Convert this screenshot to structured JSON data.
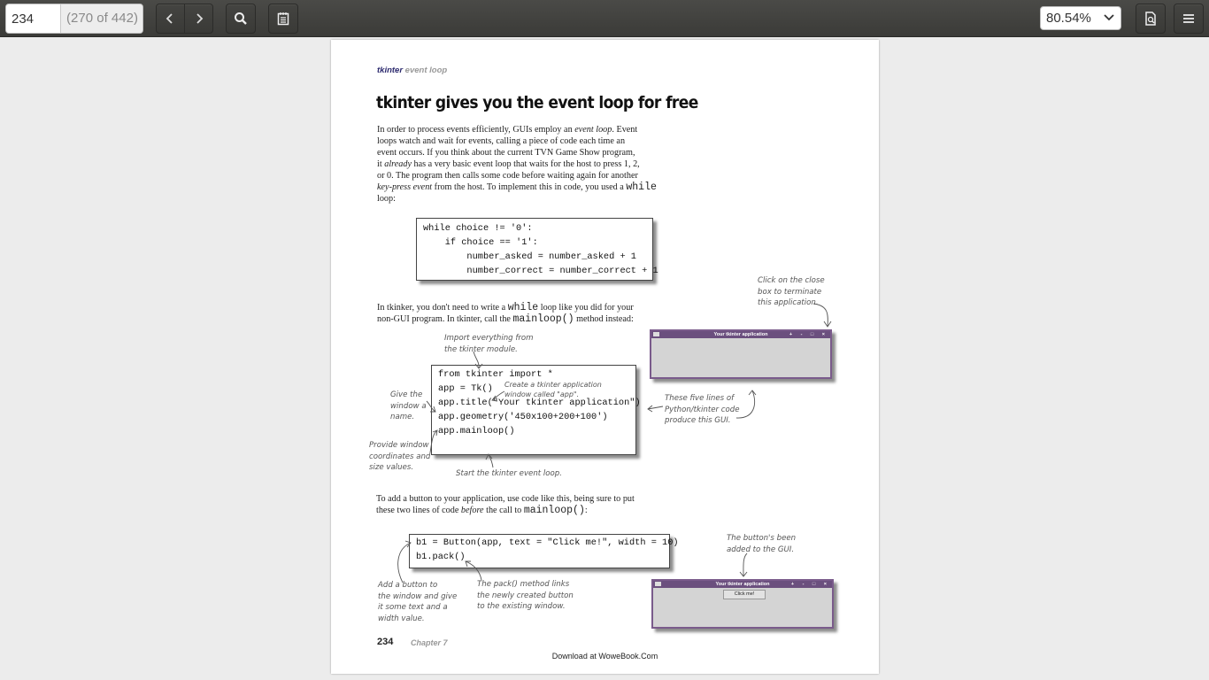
{
  "toolbar": {
    "page_number": "234",
    "page_count": "(270 of 442)",
    "zoom": "80.54%",
    "icons": [
      "chevron-left-icon",
      "chevron-right-icon",
      "search-icon",
      "annotations-icon",
      "chevron-down-icon",
      "document-properties-icon",
      "hamburger-menu-icon"
    ]
  },
  "page": {
    "header_bold": "tkinter",
    "header_rest": " event loop",
    "title": "tkinter gives you the event loop for free",
    "intro": [
      "In order to process events efficiently, GUIs employ an ",
      "event loop",
      ". Event",
      "loops watch and wait for events, calling a piece of code each time an",
      "event occurs. If you think about the current TVN Game Show program,",
      "it ",
      "already",
      " has a very basic event loop that waits for the host to press 1, 2,",
      "or 0. The program then calls some code before waiting again for another",
      "key-press event",
      " from the host. To implement this in code, you used a ",
      "while",
      "loop:"
    ],
    "code1": [
      "while choice != '0':",
      "    if choice == '1':",
      "        number_asked = number_asked + 1",
      "        number_correct = number_correct + 1"
    ],
    "para2": [
      "In tkinker, you don't need to write a ",
      "while",
      " loop like you did for your",
      "non-GUI program. In tkinter, call the ",
      "mainloop()",
      " method instead:"
    ],
    "code2": [
      "from tkinter import *",
      "",
      "app = Tk()",
      "app.title(\"Your tkinter application\")",
      "app.geometry('450x100+200+100')",
      "app.mainloop()"
    ],
    "notes": {
      "close_box": [
        "Click on the close",
        "box to terminate",
        "this application."
      ],
      "import": [
        "Import everything from",
        "the tkinter module."
      ],
      "create_app": [
        "Create a tkinter application",
        "window called \"app\"."
      ],
      "give_name": [
        "Give the",
        "window a",
        "name."
      ],
      "coords": [
        "Provide window",
        "coordinates and",
        "size values."
      ],
      "five_lines": [
        "These five lines of",
        "Python/tkinter code",
        "produce this GUI."
      ],
      "start_loop": "Start the tkinter event loop.",
      "button_added": [
        "The button's been",
        "added to the GUI."
      ],
      "add_button": [
        "Add a button to",
        "the window and give",
        "it some text and a",
        "width value."
      ],
      "pack": [
        "The pack() method links",
        "the newly created button",
        "to the existing window."
      ]
    },
    "window_title": "Your tkinter application",
    "window_buttons": "+ - □ ×",
    "button_text": "Click me!",
    "para3": [
      "To add a button to your application, use code like this, being sure to put",
      "these two lines of code ",
      "before",
      " the call to ",
      "mainloop()",
      ":"
    ],
    "code3": [
      "b1 = Button(app, text = \"Click me!\", width = 10)",
      "b1.pack()"
    ],
    "footer_page": "234",
    "footer_chapter": "Chapter 7",
    "footer_download": "Download at WoweBook.Com"
  }
}
